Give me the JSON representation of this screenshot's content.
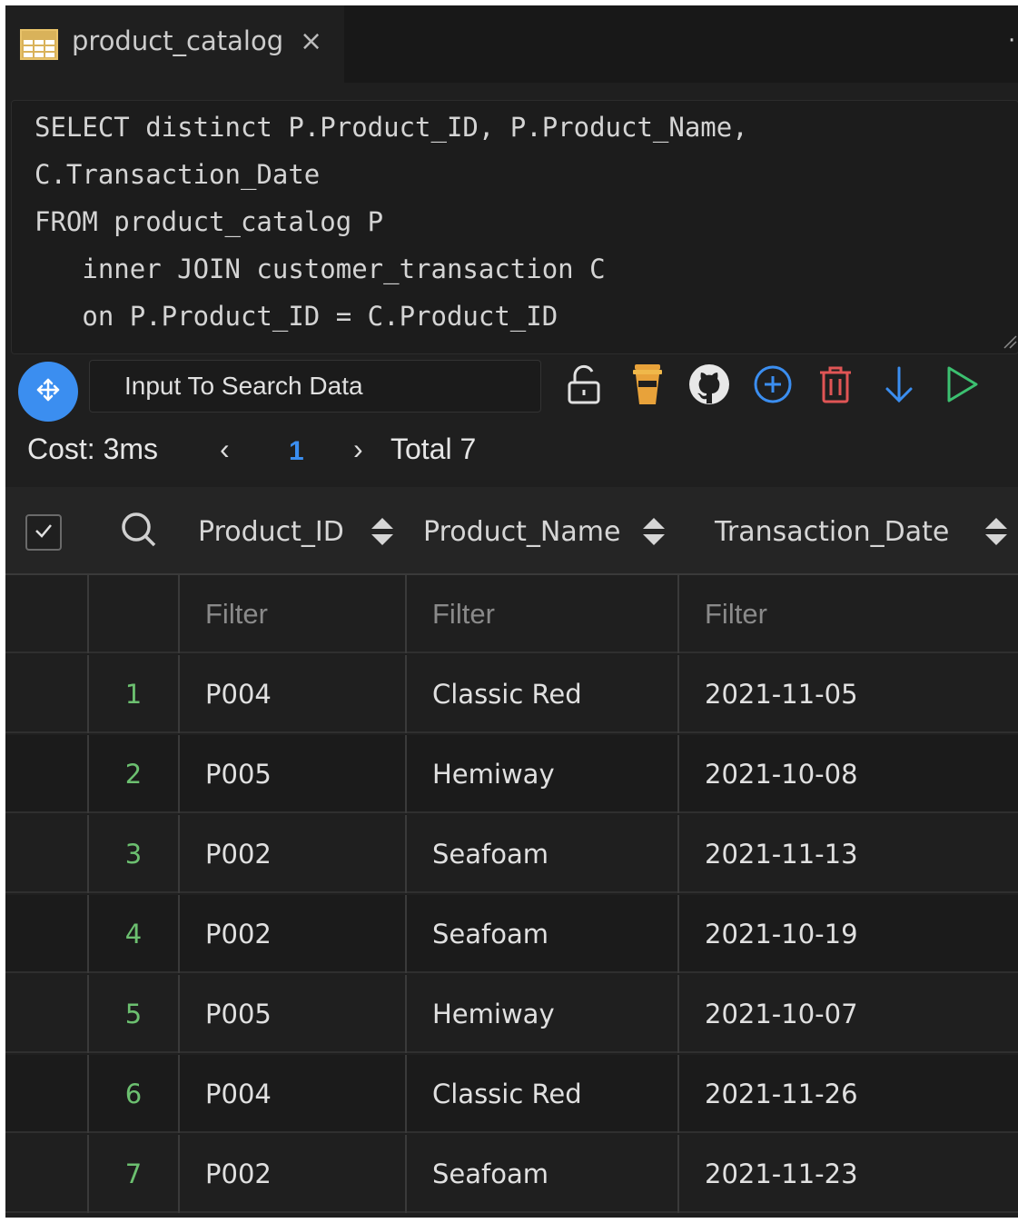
{
  "tab": {
    "title": "product_catalog",
    "close_label": "×",
    "more_label": "·"
  },
  "editor": {
    "lines": [
      "SELECT distinct P.Product_ID, P.Product_Name,",
      "C.Transaction_Date",
      "FROM product_catalog P",
      "   inner JOIN customer_transaction C",
      "   on P.Product_ID = C.Product_ID"
    ]
  },
  "toolbar": {
    "search_placeholder": "Input To Search Data",
    "icons": [
      "move-icon",
      "unlock-icon",
      "coffee-icon",
      "github-icon",
      "add-circle-icon",
      "trash-icon",
      "download-arrow-icon",
      "run-play-icon"
    ],
    "colors": {
      "move": "#3b8ef0",
      "coffee": "#e8a23a",
      "add": "#3b8ef0",
      "trash": "#e05555",
      "download": "#3b8ef0",
      "run": "#3cc070"
    }
  },
  "pagination": {
    "cost": "Cost: 3ms",
    "prev": "‹",
    "page": "1",
    "next": "›",
    "total": "Total 7"
  },
  "table": {
    "columns": [
      "Product_ID",
      "Product_Name",
      "Transaction_Date"
    ],
    "filter_placeholder": "Filter",
    "rows": [
      {
        "index": "1",
        "Product_ID": "P004",
        "Product_Name": "Classic Red",
        "Transaction_Date": "2021-11-05"
      },
      {
        "index": "2",
        "Product_ID": "P005",
        "Product_Name": "Hemiway",
        "Transaction_Date": "2021-10-08"
      },
      {
        "index": "3",
        "Product_ID": "P002",
        "Product_Name": "Seafoam",
        "Transaction_Date": "2021-11-13"
      },
      {
        "index": "4",
        "Product_ID": "P002",
        "Product_Name": "Seafoam",
        "Transaction_Date": "2021-10-19"
      },
      {
        "index": "5",
        "Product_ID": "P005",
        "Product_Name": "Hemiway",
        "Transaction_Date": "2021-10-07"
      },
      {
        "index": "6",
        "Product_ID": "P004",
        "Product_Name": "Classic Red",
        "Transaction_Date": "2021-11-26"
      },
      {
        "index": "7",
        "Product_ID": "P002",
        "Product_Name": "Seafoam",
        "Transaction_Date": "2021-11-23"
      }
    ]
  }
}
